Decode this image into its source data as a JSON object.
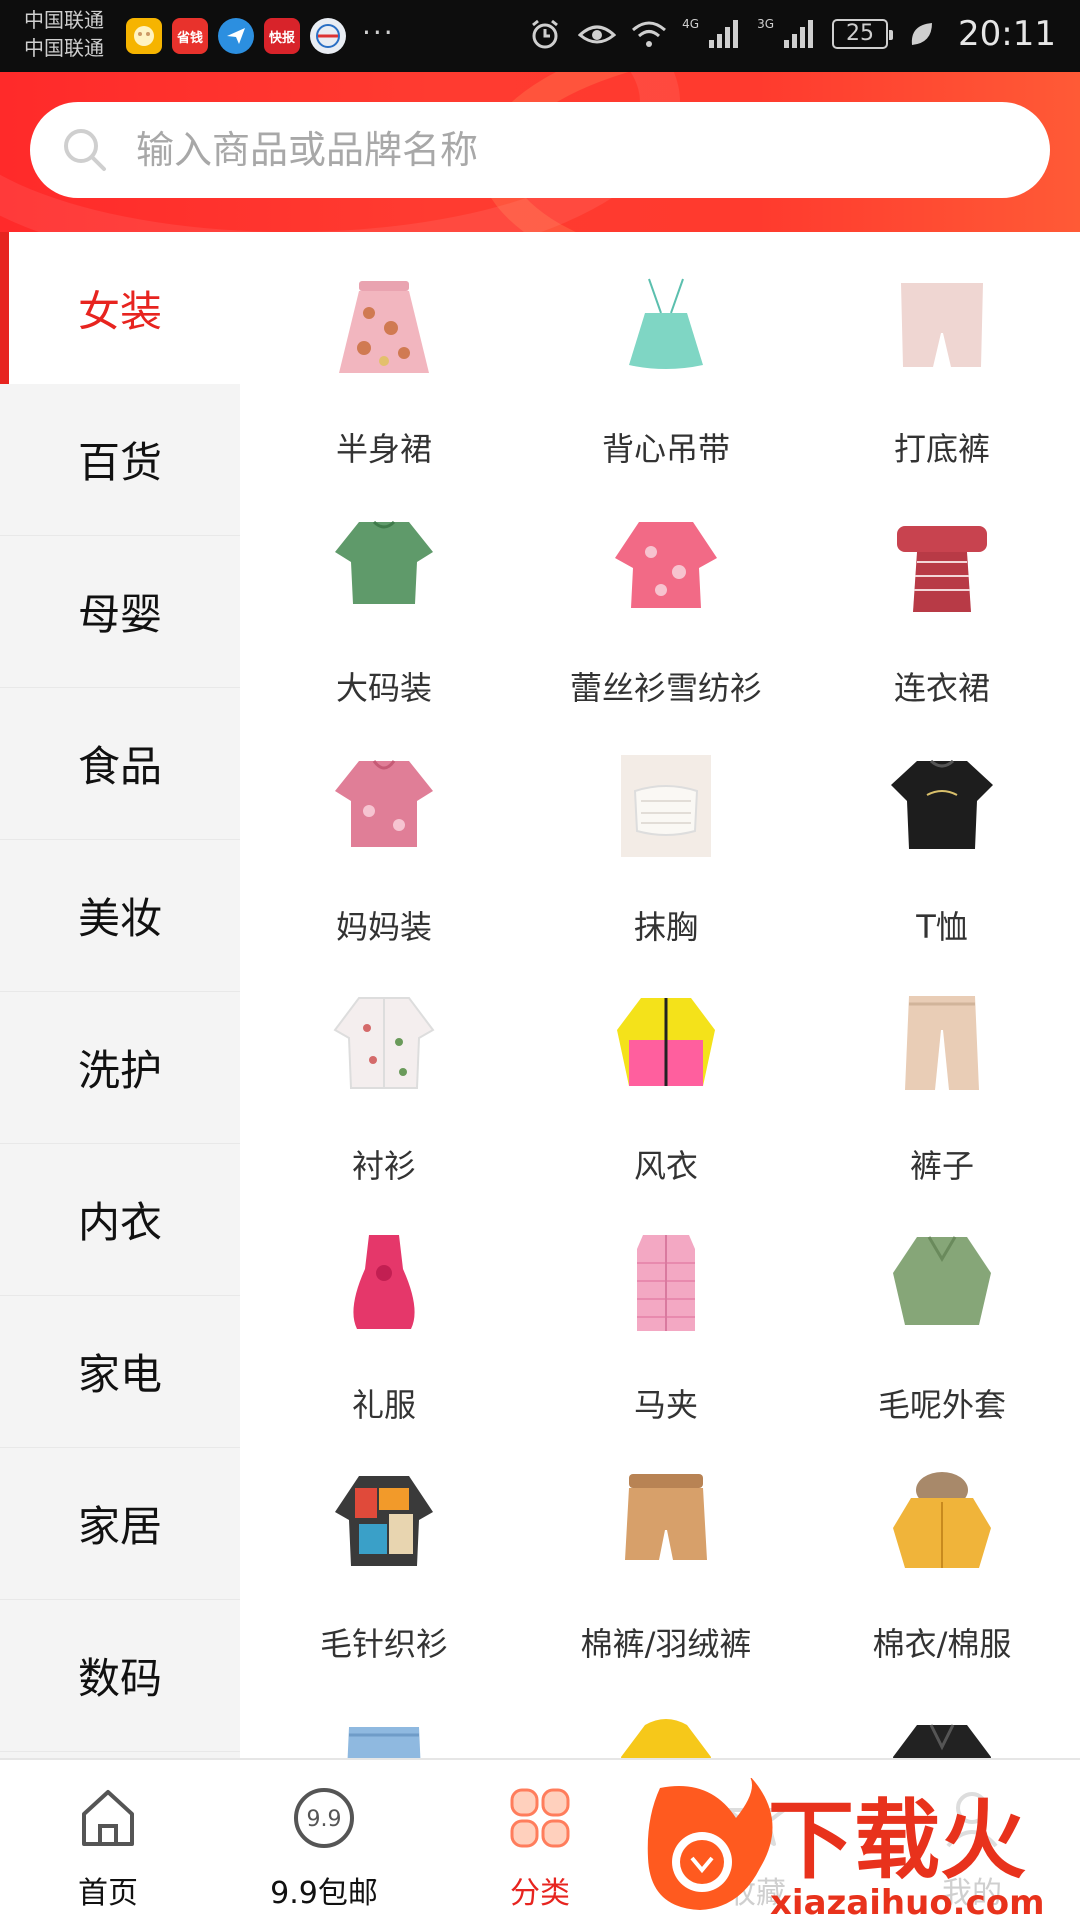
{
  "status_bar": {
    "carrier_1": "中国联通",
    "carrier_2": "中国联通",
    "notification_icons": [
      {
        "name": "app-notification-icon",
        "color": "#f6b400"
      },
      {
        "name": "shengqian-app-icon",
        "color": "#e8322c",
        "text": "省钱"
      },
      {
        "name": "paper-plane-app-icon",
        "color": "#2c8fe0"
      },
      {
        "name": "kuaibao-app-icon",
        "color": "#d8232a",
        "text": "快报"
      },
      {
        "name": "globe-app-icon",
        "color": "#e9edf3"
      }
    ],
    "more": "···",
    "net_4g": "4G",
    "net_3g": "3G",
    "battery": "25",
    "time": "20:11"
  },
  "search": {
    "placeholder": "输入商品或品牌名称",
    "icon": "search-icon"
  },
  "sidebar": {
    "items": [
      {
        "label": "女装",
        "active": true
      },
      {
        "label": "百货"
      },
      {
        "label": "母婴"
      },
      {
        "label": "食品"
      },
      {
        "label": "美妆"
      },
      {
        "label": "洗护"
      },
      {
        "label": "内衣"
      },
      {
        "label": "家电"
      },
      {
        "label": "家居"
      },
      {
        "label": "数码"
      }
    ]
  },
  "categories": [
    {
      "label": "半身裙",
      "color": "#f2b6bf"
    },
    {
      "label": "背心吊带",
      "color": "#7fd6c4"
    },
    {
      "label": "打底裤",
      "color": "#efd6d2"
    },
    {
      "label": "大码装",
      "color": "#5f9a6a"
    },
    {
      "label": "蕾丝衫雪纺衫",
      "color": "#f26a86"
    },
    {
      "label": "连衣裙",
      "color": "#c8434f"
    },
    {
      "label": "妈妈装",
      "color": "#e07e97"
    },
    {
      "label": "抹胸",
      "color": "#efe9e4"
    },
    {
      "label": "T恤",
      "color": "#1d1d1d"
    },
    {
      "label": "衬衫",
      "color": "#f4eeee"
    },
    {
      "label": "风衣",
      "color": "#f4e21a"
    },
    {
      "label": "裤子",
      "color": "#e9cdb6"
    },
    {
      "label": "礼服",
      "color": "#e5376a"
    },
    {
      "label": "马夹",
      "color": "#f3a8c3"
    },
    {
      "label": "毛呢外套",
      "color": "#86a678"
    },
    {
      "label": "毛针织衫",
      "color": "#e04a3a"
    },
    {
      "label": "棉裤/羽绒裤",
      "color": "#d7a06a"
    },
    {
      "label": "棉衣/棉服",
      "color": "#f0b43a"
    },
    {
      "label": "",
      "color": "#8fb9e0"
    },
    {
      "label": "",
      "color": "#f6c81a"
    },
    {
      "label": "",
      "color": "#222222"
    }
  ],
  "bottom_nav": {
    "tabs": [
      {
        "label": "首页",
        "icon": "home-icon"
      },
      {
        "label": "9.9包邮",
        "icon": "nine-nine-icon"
      },
      {
        "label": "分类",
        "icon": "category-icon",
        "active": true
      },
      {
        "label": "收藏",
        "icon": "star-icon"
      },
      {
        "label": "我的",
        "icon": "profile-icon"
      }
    ]
  },
  "watermark": {
    "brand": "下载火",
    "domain": "xiazaihuo.com"
  },
  "colors": {
    "accent": "#e7241f",
    "header_gradient_start": "#ff2a2a",
    "header_gradient_end": "#ff5a36",
    "sidebar_bg": "#f4f4f4"
  }
}
